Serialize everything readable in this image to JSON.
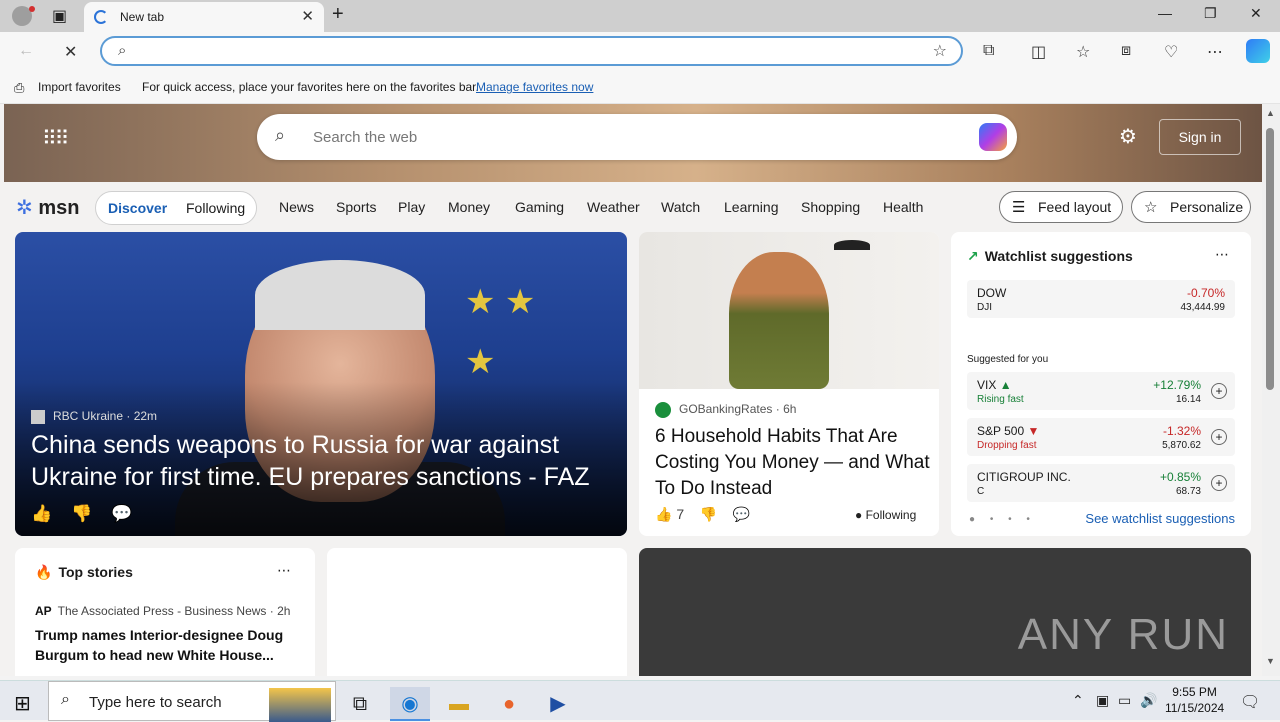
{
  "browser": {
    "tab_title": "New tab",
    "favorites_bar": {
      "import_label": "Import favorites",
      "hint_text": "For quick access, place your favorites here on the favorites bar.",
      "manage_link": "Manage favorites now"
    }
  },
  "msn": {
    "search_placeholder": "Search the web",
    "sign_in": "Sign in",
    "logo_text": "msn",
    "segments": [
      "Discover",
      "Following"
    ],
    "nav": [
      "News",
      "Sports",
      "Play",
      "Money",
      "Gaming",
      "Weather",
      "Watch",
      "Learning",
      "Shopping",
      "Health"
    ],
    "feed_layout": "Feed layout",
    "personalize": "Personalize"
  },
  "hero": {
    "source": "RBC Ukraine",
    "age": "22m",
    "headline": "China sends weapons to Russia for war against Ukraine for first time. EU prepares sanctions - FAZ"
  },
  "card2": {
    "source": "GOBankingRates",
    "age": "6h",
    "headline": "6 Household Habits That Are Costing You Money — and What To Do Instead",
    "likes": "7",
    "following": "Following"
  },
  "watchlist": {
    "title": "Watchlist suggestions",
    "featured": {
      "name": "DOW",
      "symbol": "DJI",
      "change": "-0.70%",
      "price": "43,444.99"
    },
    "suggested_label": "Suggested for you",
    "items": [
      {
        "name": "VIX",
        "tag": "Rising fast",
        "change": "+12.79%",
        "price": "16.14"
      },
      {
        "name": "S&P 500",
        "tag": "Dropping fast",
        "change": "-1.32%",
        "price": "5,870.62"
      },
      {
        "name": "CITIGROUP INC.",
        "tag": "C",
        "change": "+0.85%",
        "price": "68.73"
      }
    ],
    "link": "See watchlist suggestions"
  },
  "top_stories": {
    "title": "Top stories",
    "source": "The Associated Press - Business News",
    "age": "2h",
    "source_logo": "AP",
    "headline": "Trump names Interior-designee Doug Burgum to head new White House..."
  },
  "watermark": "ANY RUN",
  "taskbar": {
    "search_placeholder": "Type here to search",
    "time": "9:55 PM",
    "date": "11/15/2024"
  },
  "colors": {
    "accent": "#1a5fb4",
    "positive": "#188038",
    "negative": "#c62828"
  }
}
